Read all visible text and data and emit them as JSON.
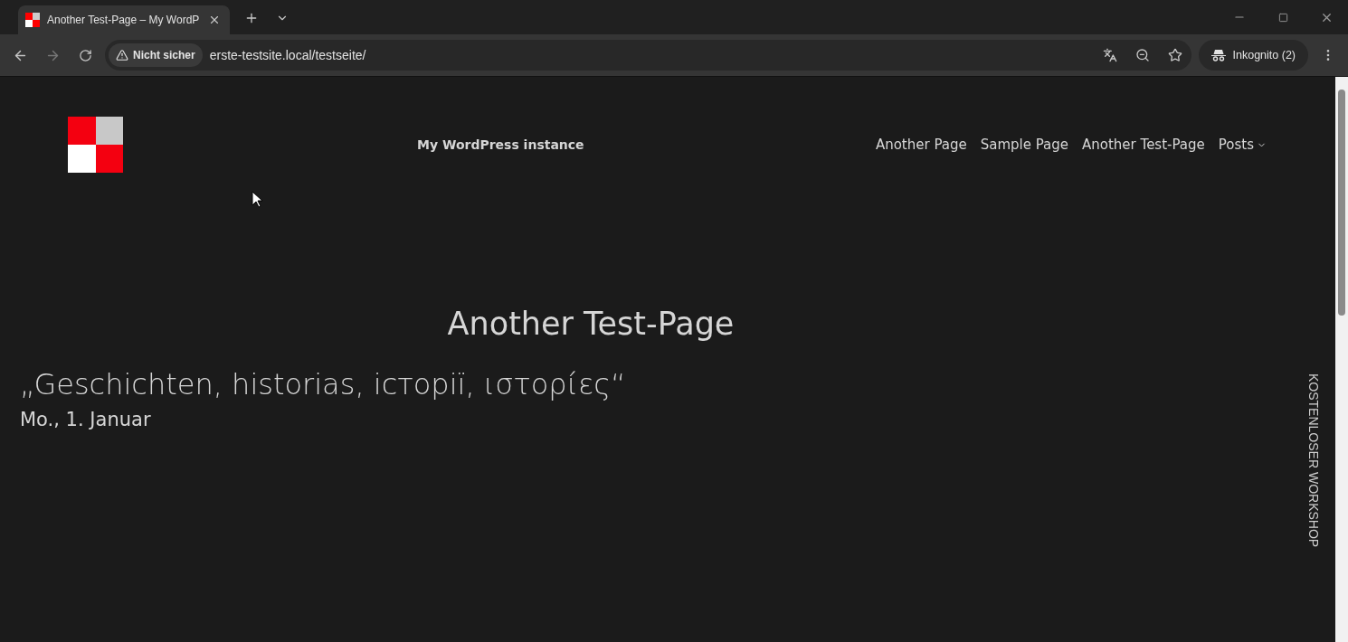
{
  "browser": {
    "tab": {
      "title": "Another Test-Page – My WordP",
      "selected": true
    },
    "security": "Nicht sicher",
    "address": "erste-testsite.local/testseite/",
    "profile": "Inkognito (2)"
  },
  "site": {
    "title": "My WordPress instance",
    "nav": [
      {
        "label": "Another Page",
        "has_menu": false
      },
      {
        "label": "Sample Page",
        "has_menu": false
      },
      {
        "label": "Another Test-Page",
        "has_menu": false
      },
      {
        "label": "Posts",
        "has_menu": true
      }
    ]
  },
  "page": {
    "heading": "Another Test-Page",
    "quote": "„Geschichten, historias, історії, ιστορίες“",
    "date": "Mo., 1. Januar"
  },
  "side_label": "KOSTENLOSER WORKSHOP"
}
